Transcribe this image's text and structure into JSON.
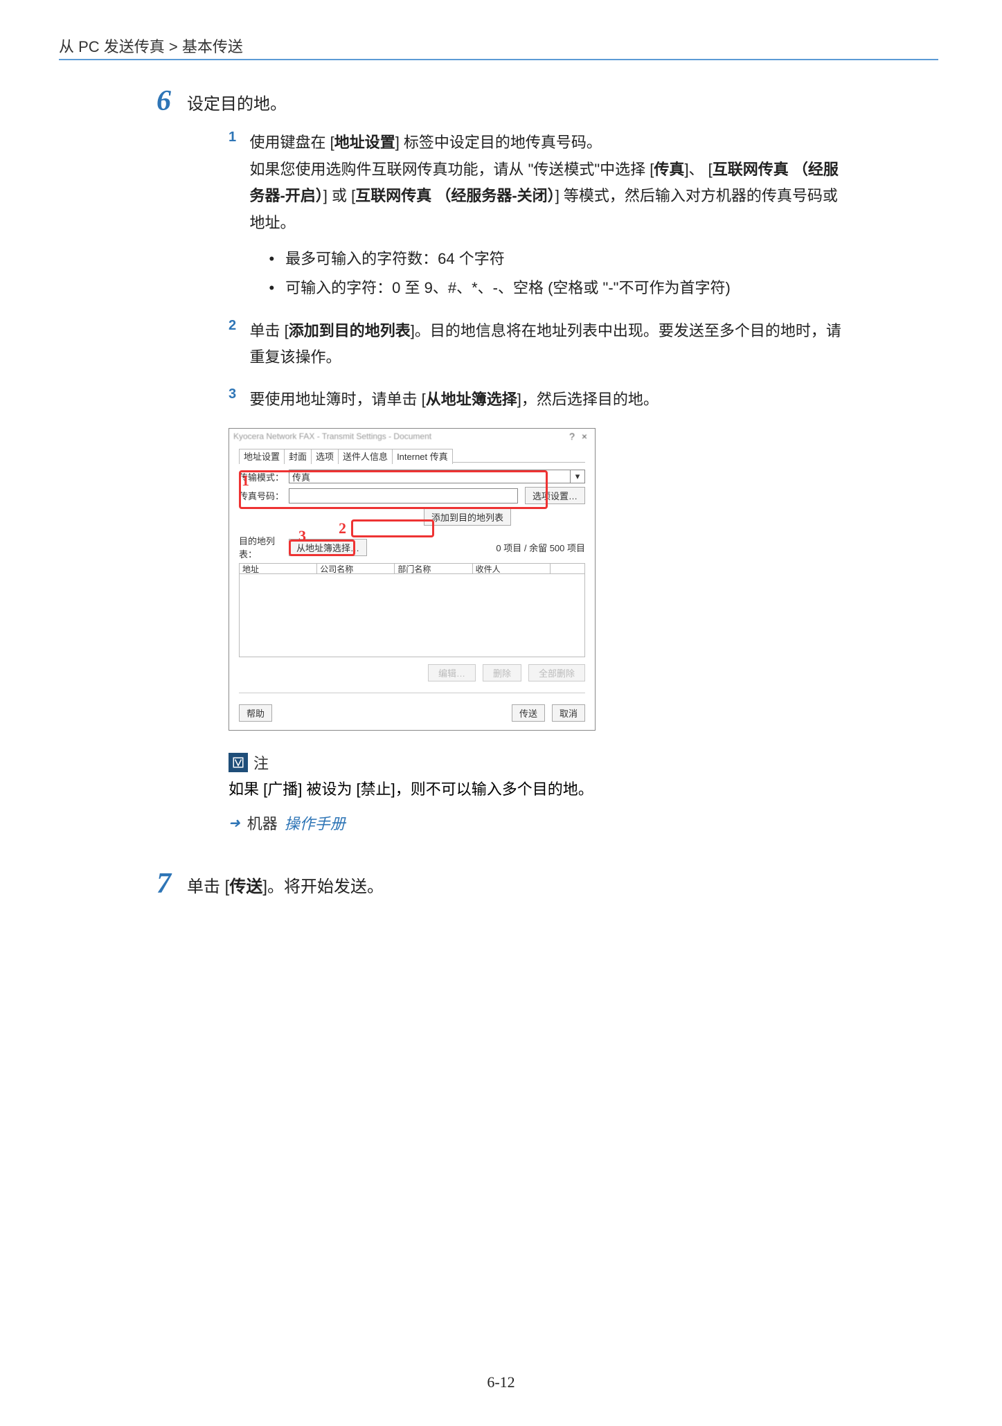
{
  "header": {
    "breadcrumb": "从 PC 发送传真 > 基本传送"
  },
  "step6": {
    "number": "6",
    "title": "设定目的地。",
    "sub1": {
      "num": "1",
      "line1_pre": "使用键盘在 [",
      "line1_bold": "地址设置",
      "line1_post": "] 标签中设定目的地传真号码。",
      "line2_pre": "如果您使用选购件互联网传真功能，请从 \"传送模式\"中选择 [",
      "line2_b1": "传真",
      "line2_mid1": "]、 [",
      "line2_b2": "互联网传真 （经服务器-开启）",
      "line2_mid2": "] 或 [",
      "line2_b3": "互联网传真 （经服务器-关闭）",
      "line2_post": "] 等模式，然后输入对方机器的传真号码或地址。",
      "bullet1": "最多可输入的字符数：64 个字符",
      "bullet2": "可输入的字符：0 至 9、#、*、-、空格 (空格或 \"-\"不可作为首字符)"
    },
    "sub2": {
      "num": "2",
      "pre": "单击 [",
      "bold": "添加到目的地列表",
      "post": "]。目的地信息将在地址列表中出现。要发送至多个目的地时，请重复该操作。"
    },
    "sub3": {
      "num": "3",
      "pre": "要使用地址簿时，请单击 [",
      "bold": "从地址簿选择",
      "post": "]，然后选择目的地。"
    }
  },
  "dialog": {
    "blurred_title": "Kyocera Network FAX - Transmit Settings - Document",
    "help_btn": "?",
    "close_btn": "×",
    "tabs": [
      "地址设置",
      "封面",
      "选项",
      "送件人信息",
      "Internet 传真"
    ],
    "mode_label": "传输模式：",
    "mode_value": "传真",
    "fax_label": "传真号码：",
    "option_btn": "选项设置…",
    "add_btn": "添加到目的地列表",
    "dest_label": "目的地列表：",
    "from_book_btn": "从地址簿选择…",
    "count_text": "0 项目 / 余留 500 项目",
    "cols": [
      "地址",
      "公司名称",
      "部门名称",
      "收件人",
      ""
    ],
    "edit_btn": "编辑…",
    "del_btn": "删除",
    "del_all_btn": "全部删除",
    "help_text": "帮助",
    "send_btn": "传送",
    "cancel_btn": "取消",
    "markers": {
      "r1": "1",
      "r2": "2",
      "r3": "3"
    }
  },
  "note": {
    "icon_title": "注",
    "text": "如果 [广播] 被设为 [禁止]，则不可以输入多个目的地。",
    "ref_arrow": "➜",
    "ref_pre": "机器",
    "ref_italic": "操作手册"
  },
  "step7": {
    "number": "7",
    "pre": "单击 [",
    "bold": "传送",
    "post": "]。将开始发送。"
  },
  "page_number": "6-12"
}
